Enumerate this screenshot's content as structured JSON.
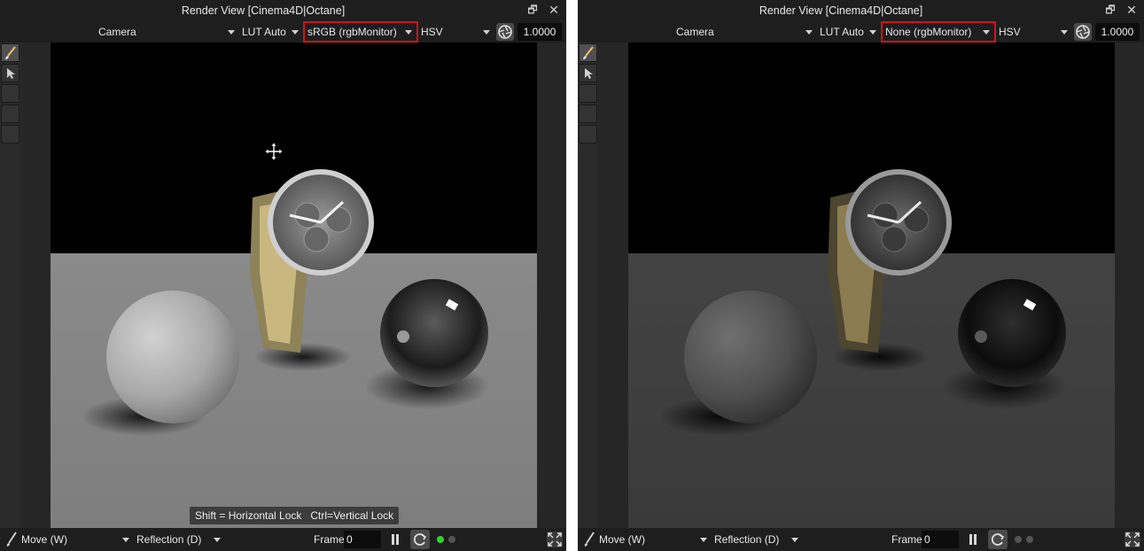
{
  "panels": [
    {
      "title": "Render View [Cinema4D|Octane]",
      "camera": "Camera",
      "lut": "LUT Auto",
      "colorspace": "sRGB (rgbMonitor)",
      "mode": "HSV",
      "value": "1.0000",
      "hint": "Shift = Horizontal Lock   Ctrl=Vertical Lock",
      "tool": "Move (W)",
      "pass": "Reflection (D)",
      "frame_label": "Frame",
      "frame_value": "0",
      "status_dot_color": "#2bd62b"
    },
    {
      "title": "Render View [Cinema4D|Octane]",
      "camera": "Camera",
      "lut": "LUT Auto",
      "colorspace": "None (rgbMonitor)",
      "mode": "HSV",
      "value": "1.0000",
      "tool": "Move (W)",
      "pass": "Reflection (D)",
      "frame_label": "Frame",
      "frame_value": "0",
      "status_dot_color": "#555555"
    }
  ],
  "highlight_color": "#d2121a",
  "icons": [
    "restore-icon",
    "close-icon",
    "aperture-icon",
    "brush-icon",
    "pointer-icon",
    "move-cursor-icon",
    "pause-icon",
    "refresh-icon",
    "fullscreen-icon"
  ]
}
